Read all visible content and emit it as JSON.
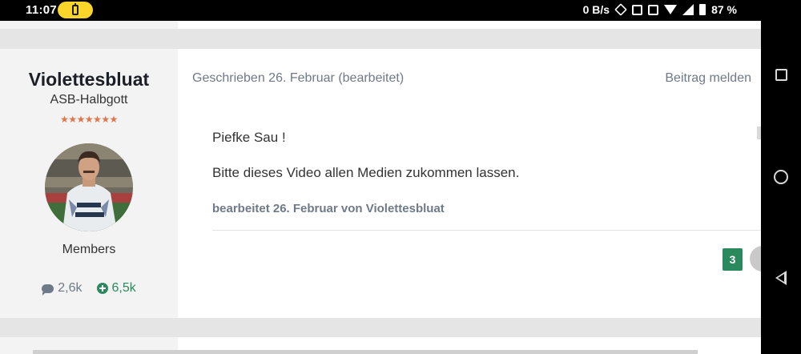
{
  "status_bar": {
    "time": "11:07",
    "network_speed": "0 B/s",
    "battery_percent": "87 %",
    "icons": [
      "battery-saver-icon",
      "rotate-icon",
      "nfc-icon",
      "vibrate-icon",
      "wifi-icon",
      "signal-icon",
      "battery-icon"
    ]
  },
  "author": {
    "name": "Violettesbluat",
    "rank": "ASB-Halbgott",
    "stars": "★★★★★★★",
    "group": "Members",
    "posts_count": "2,6k",
    "reputation": "6,5k"
  },
  "post": {
    "meta": "Geschrieben 26. Februar (bearbeitet)",
    "report_label": "Beitrag melden",
    "lines": [
      "Piefke Sau !",
      "Bitte dieses Video allen Medien zukommen lassen."
    ],
    "edit_note": "bearbeitet 26. Februar von Violettesbluat",
    "reaction_count": "3"
  },
  "colors": {
    "accent_green": "#2a8a5e",
    "muted_text": "#6f7a89",
    "star_orange": "#e0744a",
    "status_pill": "#fad52a"
  },
  "nav_bar": {
    "buttons": [
      "recent-apps-button",
      "home-button",
      "back-button"
    ]
  }
}
